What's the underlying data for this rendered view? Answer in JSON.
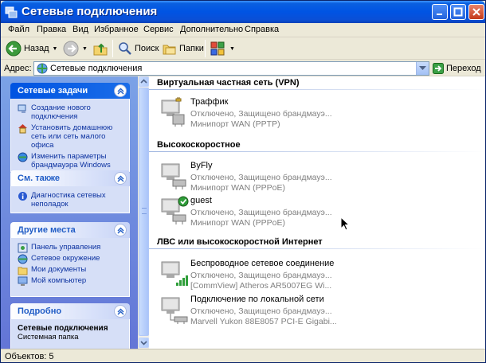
{
  "window": {
    "title": "Сетевые подключения"
  },
  "menu": [
    "Файл",
    "Правка",
    "Вид",
    "Избранное",
    "Сервис",
    "Дополнительно",
    "Справка"
  ],
  "toolbar": {
    "back_label": "Назад",
    "search_label": "Поиск",
    "folders_label": "Папки"
  },
  "address": {
    "label": "Адрес:",
    "value": "Сетевые подключения",
    "go_label": "Переход"
  },
  "sidebar": {
    "network_tasks": {
      "title": "Сетевые задачи",
      "items": [
        "Создание нового подключения",
        "Установить домашнюю сеть или сеть малого офиса",
        "Изменить параметры брандмауэра Windows"
      ]
    },
    "see_also": {
      "title": "См. также",
      "items": [
        "Диагностика сетевых неполадок"
      ]
    },
    "other_places": {
      "title": "Другие места",
      "items": [
        "Панель управления",
        "Сетевое окружение",
        "Мои документы",
        "Мой компьютер"
      ]
    },
    "details": {
      "title": "Подробно",
      "name": "Сетевые подключения",
      "type": "Системная папка"
    }
  },
  "groups": [
    {
      "title": "Виртуальная частная сеть (VPN)",
      "connections": [
        {
          "name": "Траффик",
          "status": "Отключено, Защищено брандмауэ...",
          "device": "Минипорт WAN (PPTP)",
          "kind": "vpn"
        }
      ]
    },
    {
      "title": "Высокоскоростное",
      "connections": [
        {
          "name": "ByFly",
          "status": "Отключено, Защищено брандмауэ...",
          "device": "Минипорт WAN (PPPoE)",
          "kind": "broadband"
        },
        {
          "name": "guest",
          "status": "Отключено, Защищено брандмауэ...",
          "device": "Минипорт WAN (PPPoE)",
          "kind": "broadband-default"
        }
      ]
    },
    {
      "title": "ЛВС или высокоскоростной Интернет",
      "connections": [
        {
          "name": "Беспроводное сетевое соединение",
          "status": "Отключено, Защищено брандмауэ...",
          "device": "[CommView] Atheros AR5007EG Wi...",
          "kind": "wireless"
        },
        {
          "name": "Подключение по локальной сети",
          "status": "Отключено, Защищено брандмауэ...",
          "device": "Marvell Yukon 88E8057 PCI-E Gigabi...",
          "kind": "lan"
        }
      ]
    }
  ],
  "status_bar": {
    "text": "Объектов: 5"
  }
}
